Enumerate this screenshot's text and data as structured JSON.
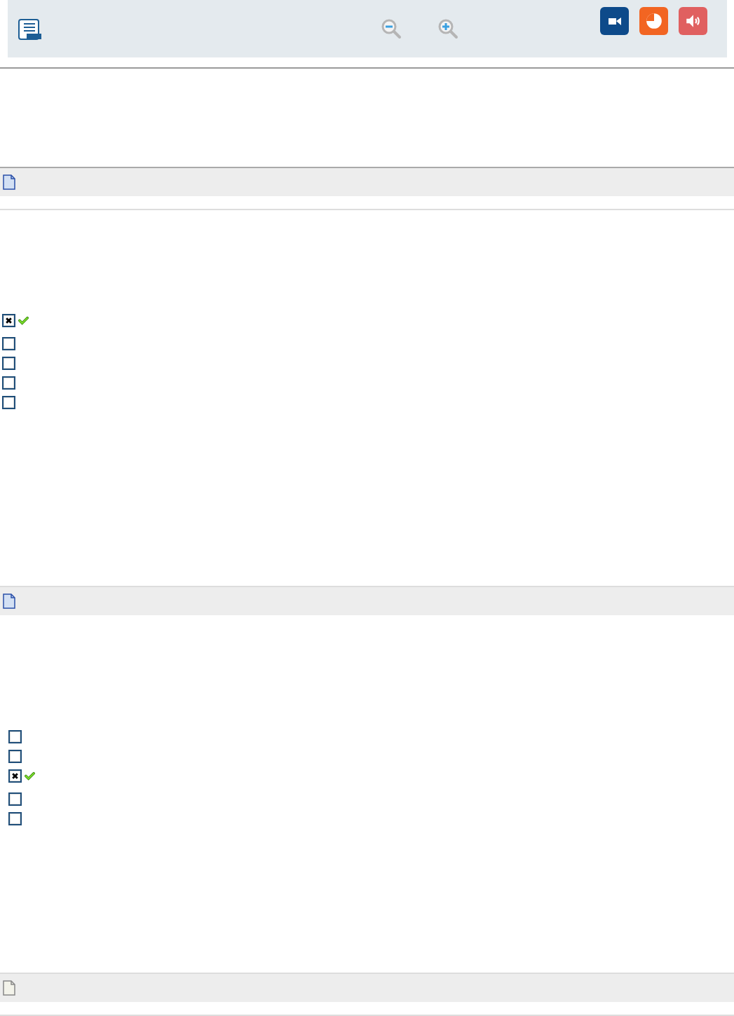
{
  "toolbar": {
    "tools": [
      {
        "kind": "zoom-out"
      },
      {
        "kind": "zoom-in"
      }
    ],
    "media": [
      {
        "kind": "video",
        "color": "#0d4a8a"
      },
      {
        "kind": "chart",
        "color": "#f26522"
      },
      {
        "kind": "audio",
        "color": "#e06060"
      }
    ]
  },
  "sections": [
    {
      "kind": "question",
      "options": [
        {
          "checked": true,
          "correct": true
        },
        {
          "checked": false,
          "correct": false
        },
        {
          "checked": false,
          "correct": false
        },
        {
          "checked": false,
          "correct": false
        },
        {
          "checked": false,
          "correct": false
        }
      ]
    },
    {
      "kind": "question",
      "options": [
        {
          "checked": false,
          "correct": false
        },
        {
          "checked": false,
          "correct": false
        },
        {
          "checked": true,
          "correct": true
        },
        {
          "checked": false,
          "correct": false
        },
        {
          "checked": false,
          "correct": false
        }
      ]
    },
    {
      "kind": "blank"
    }
  ]
}
